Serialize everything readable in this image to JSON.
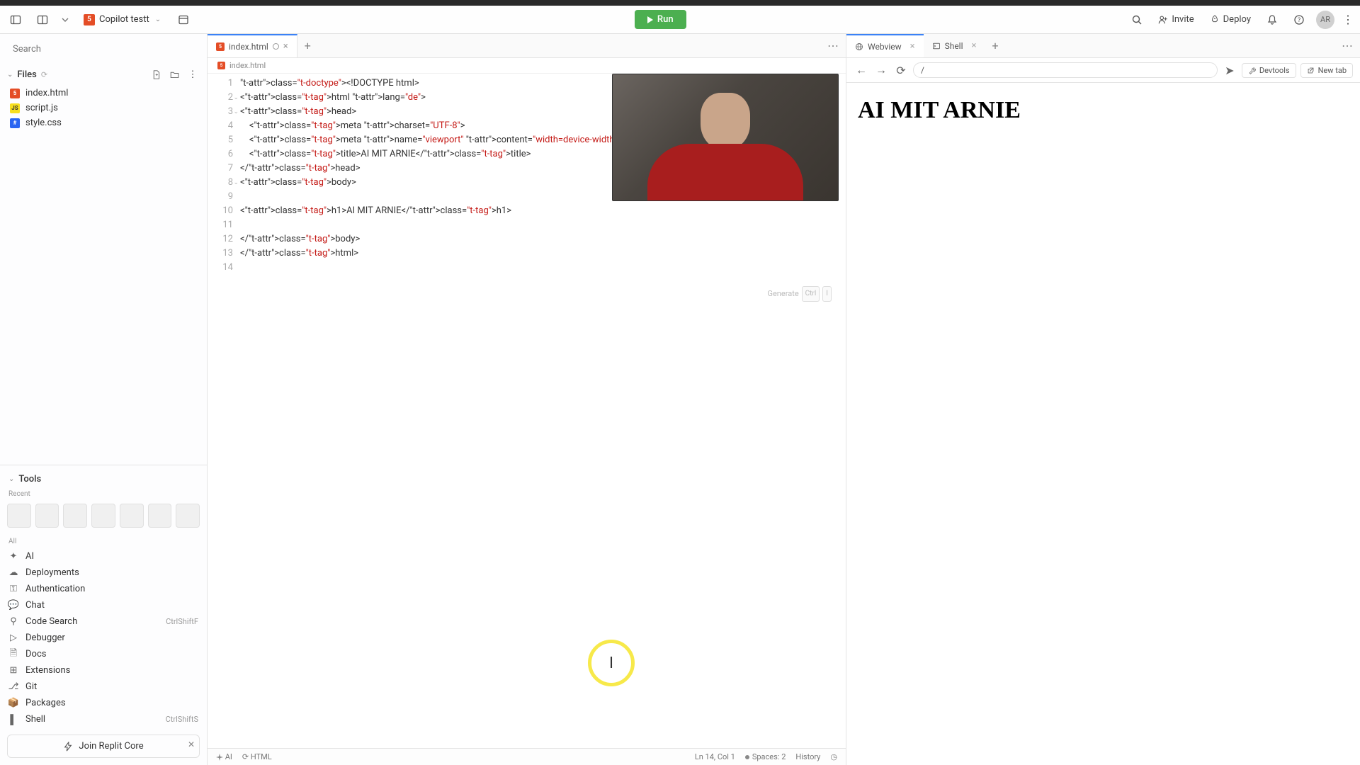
{
  "header": {
    "project_name": "Copilot testt",
    "run_label": "Run",
    "invite_label": "Invite",
    "deploy_label": "Deploy",
    "avatar_initials": "AR"
  },
  "sidebar": {
    "search_placeholder": "Search",
    "files_label": "Files",
    "files": [
      {
        "name": "index.html",
        "kind": "html"
      },
      {
        "name": "script.js",
        "kind": "js"
      },
      {
        "name": "style.css",
        "kind": "css"
      }
    ],
    "tools_label": "Tools",
    "recent_label": "Recent",
    "all_label": "All",
    "tools": [
      {
        "name": "AI",
        "shortcut": ""
      },
      {
        "name": "Deployments",
        "shortcut": ""
      },
      {
        "name": "Authentication",
        "shortcut": ""
      },
      {
        "name": "Chat",
        "shortcut": ""
      },
      {
        "name": "Code Search",
        "shortcut": "CtrlShiftF"
      },
      {
        "name": "Debugger",
        "shortcut": ""
      },
      {
        "name": "Docs",
        "shortcut": ""
      },
      {
        "name": "Extensions",
        "shortcut": ""
      },
      {
        "name": "Git",
        "shortcut": ""
      },
      {
        "name": "Packages",
        "shortcut": ""
      },
      {
        "name": "Shell",
        "shortcut": "CtrlShiftS"
      }
    ],
    "join_core_label": "Join Replit Core"
  },
  "editor": {
    "tab_label": "index.html",
    "breadcrumb": "index.html",
    "lines": [
      "<!DOCTYPE html>",
      "<html lang=\"de\">",
      "<head>",
      "    <meta charset=\"UTF-8\">",
      "    <meta name=\"viewport\" content=\"width=device-width, ini",
      "    <title>AI MIT ARNIE</title>",
      "</head>",
      "<body>",
      "",
      "<h1>AI MIT ARNIE</h1>",
      "",
      "</body>",
      "</html>",
      ""
    ],
    "generate_label": "Generate",
    "generate_kbd1": "Ctrl",
    "generate_kbd2": "I",
    "status": {
      "ai": "AI",
      "lang": "HTML",
      "pos": "Ln 14, Col 1",
      "spaces": "Spaces: 2",
      "history": "History"
    }
  },
  "preview": {
    "tabs": [
      {
        "label": "Webview",
        "active": true
      },
      {
        "label": "Shell",
        "active": false
      }
    ],
    "address": "/",
    "devtools_label": "Devtools",
    "newtab_label": "New tab",
    "heading": "AI MIT ARNIE"
  },
  "cursor_overlay_glyph": "I"
}
